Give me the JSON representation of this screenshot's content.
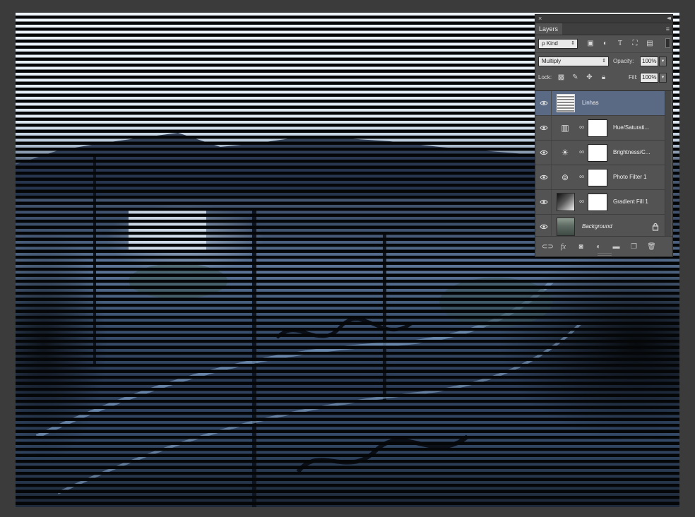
{
  "canvas": {
    "description_layer": "Linhas"
  },
  "panel": {
    "tab": "Layers",
    "close_glyph": "×",
    "collapse_glyph": "«",
    "menu_glyph": "≡",
    "filter": {
      "kind_label": "ρ Kind",
      "icons": [
        "image-filter-icon",
        "adjustment-filter-icon",
        "type-filter-icon",
        "shape-filter-icon",
        "smart-object-filter-icon"
      ]
    },
    "blend_mode": "Multiply",
    "opacity_label": "Opacity:",
    "opacity_value": "100%",
    "lock_label": "Lock:",
    "fill_label": "Fill:",
    "fill_value": "100%",
    "layers": [
      {
        "name": "Linhas",
        "selected": true,
        "kind": "pixel"
      },
      {
        "name": "Hue/Saturati...",
        "selected": false,
        "kind": "adjustment",
        "icon": "hue-saturation-icon"
      },
      {
        "name": "Brightness/C...",
        "selected": false,
        "kind": "adjustment",
        "icon": "brightness-contrast-icon"
      },
      {
        "name": "Photo Filter 1",
        "selected": false,
        "kind": "adjustment",
        "icon": "photo-filter-icon"
      },
      {
        "name": "Gradient Fill 1",
        "selected": false,
        "kind": "gradient"
      },
      {
        "name": "Background",
        "selected": false,
        "kind": "background",
        "locked": true
      }
    ],
    "footer_icons": [
      "link-layers-icon",
      "fx-icon",
      "add-mask-icon",
      "new-adjustment-icon",
      "new-group-icon",
      "new-layer-icon",
      "delete-layer-icon"
    ],
    "fx_label": "fx"
  },
  "colors": {
    "panel_bg": "#535353",
    "selected_row": "#5a6a85",
    "app_bg": "#3b3b3b"
  }
}
